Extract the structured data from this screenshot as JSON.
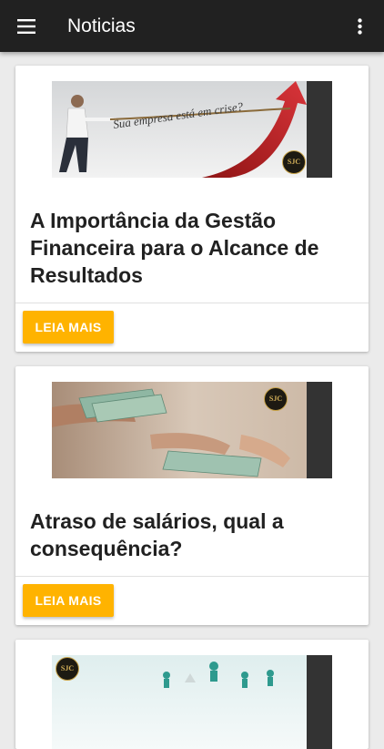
{
  "app_bar": {
    "title": "Noticias",
    "menu_icon": "hamburger-menu-icon",
    "overflow_icon": "more-vert-icon"
  },
  "colors": {
    "app_bar": "#212121",
    "button": "#ffb300",
    "background": "#ebebeb"
  },
  "articles": [
    {
      "title": "A Importância da Gestão Financeira para o Alcance de Resultados",
      "image_caption": "Sua empresa está em crise?",
      "logo_text": "SJC",
      "button_label": "LEIA MAIS"
    },
    {
      "title": "Atraso de salários, qual a consequência?",
      "logo_text": "SJC",
      "button_label": "LEIA MAIS"
    },
    {
      "logo_text": "SJC"
    }
  ]
}
